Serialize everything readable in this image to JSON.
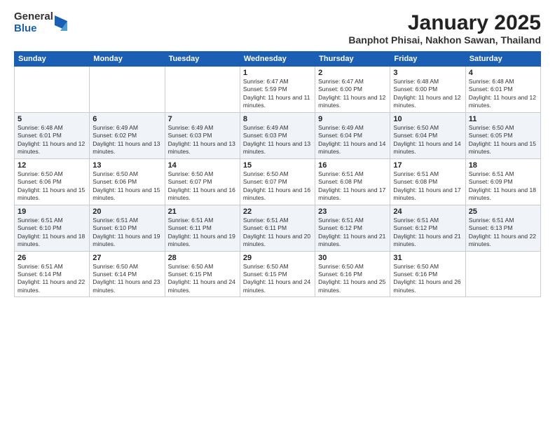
{
  "logo": {
    "general": "General",
    "blue": "Blue"
  },
  "title": "January 2025",
  "location": "Banphot Phisai, Nakhon Sawan, Thailand",
  "days_of_week": [
    "Sunday",
    "Monday",
    "Tuesday",
    "Wednesday",
    "Thursday",
    "Friday",
    "Saturday"
  ],
  "weeks": [
    [
      {
        "day": "",
        "sunrise": "",
        "sunset": "",
        "daylight": ""
      },
      {
        "day": "",
        "sunrise": "",
        "sunset": "",
        "daylight": ""
      },
      {
        "day": "",
        "sunrise": "",
        "sunset": "",
        "daylight": ""
      },
      {
        "day": "1",
        "sunrise": "Sunrise: 6:47 AM",
        "sunset": "Sunset: 5:59 PM",
        "daylight": "Daylight: 11 hours and 11 minutes."
      },
      {
        "day": "2",
        "sunrise": "Sunrise: 6:47 AM",
        "sunset": "Sunset: 6:00 PM",
        "daylight": "Daylight: 11 hours and 12 minutes."
      },
      {
        "day": "3",
        "sunrise": "Sunrise: 6:48 AM",
        "sunset": "Sunset: 6:00 PM",
        "daylight": "Daylight: 11 hours and 12 minutes."
      },
      {
        "day": "4",
        "sunrise": "Sunrise: 6:48 AM",
        "sunset": "Sunset: 6:01 PM",
        "daylight": "Daylight: 11 hours and 12 minutes."
      }
    ],
    [
      {
        "day": "5",
        "sunrise": "Sunrise: 6:48 AM",
        "sunset": "Sunset: 6:01 PM",
        "daylight": "Daylight: 11 hours and 12 minutes."
      },
      {
        "day": "6",
        "sunrise": "Sunrise: 6:49 AM",
        "sunset": "Sunset: 6:02 PM",
        "daylight": "Daylight: 11 hours and 13 minutes."
      },
      {
        "day": "7",
        "sunrise": "Sunrise: 6:49 AM",
        "sunset": "Sunset: 6:03 PM",
        "daylight": "Daylight: 11 hours and 13 minutes."
      },
      {
        "day": "8",
        "sunrise": "Sunrise: 6:49 AM",
        "sunset": "Sunset: 6:03 PM",
        "daylight": "Daylight: 11 hours and 13 minutes."
      },
      {
        "day": "9",
        "sunrise": "Sunrise: 6:49 AM",
        "sunset": "Sunset: 6:04 PM",
        "daylight": "Daylight: 11 hours and 14 minutes."
      },
      {
        "day": "10",
        "sunrise": "Sunrise: 6:50 AM",
        "sunset": "Sunset: 6:04 PM",
        "daylight": "Daylight: 11 hours and 14 minutes."
      },
      {
        "day": "11",
        "sunrise": "Sunrise: 6:50 AM",
        "sunset": "Sunset: 6:05 PM",
        "daylight": "Daylight: 11 hours and 15 minutes."
      }
    ],
    [
      {
        "day": "12",
        "sunrise": "Sunrise: 6:50 AM",
        "sunset": "Sunset: 6:06 PM",
        "daylight": "Daylight: 11 hours and 15 minutes."
      },
      {
        "day": "13",
        "sunrise": "Sunrise: 6:50 AM",
        "sunset": "Sunset: 6:06 PM",
        "daylight": "Daylight: 11 hours and 15 minutes."
      },
      {
        "day": "14",
        "sunrise": "Sunrise: 6:50 AM",
        "sunset": "Sunset: 6:07 PM",
        "daylight": "Daylight: 11 hours and 16 minutes."
      },
      {
        "day": "15",
        "sunrise": "Sunrise: 6:50 AM",
        "sunset": "Sunset: 6:07 PM",
        "daylight": "Daylight: 11 hours and 16 minutes."
      },
      {
        "day": "16",
        "sunrise": "Sunrise: 6:51 AM",
        "sunset": "Sunset: 6:08 PM",
        "daylight": "Daylight: 11 hours and 17 minutes."
      },
      {
        "day": "17",
        "sunrise": "Sunrise: 6:51 AM",
        "sunset": "Sunset: 6:08 PM",
        "daylight": "Daylight: 11 hours and 17 minutes."
      },
      {
        "day": "18",
        "sunrise": "Sunrise: 6:51 AM",
        "sunset": "Sunset: 6:09 PM",
        "daylight": "Daylight: 11 hours and 18 minutes."
      }
    ],
    [
      {
        "day": "19",
        "sunrise": "Sunrise: 6:51 AM",
        "sunset": "Sunset: 6:10 PM",
        "daylight": "Daylight: 11 hours and 18 minutes."
      },
      {
        "day": "20",
        "sunrise": "Sunrise: 6:51 AM",
        "sunset": "Sunset: 6:10 PM",
        "daylight": "Daylight: 11 hours and 19 minutes."
      },
      {
        "day": "21",
        "sunrise": "Sunrise: 6:51 AM",
        "sunset": "Sunset: 6:11 PM",
        "daylight": "Daylight: 11 hours and 19 minutes."
      },
      {
        "day": "22",
        "sunrise": "Sunrise: 6:51 AM",
        "sunset": "Sunset: 6:11 PM",
        "daylight": "Daylight: 11 hours and 20 minutes."
      },
      {
        "day": "23",
        "sunrise": "Sunrise: 6:51 AM",
        "sunset": "Sunset: 6:12 PM",
        "daylight": "Daylight: 11 hours and 21 minutes."
      },
      {
        "day": "24",
        "sunrise": "Sunrise: 6:51 AM",
        "sunset": "Sunset: 6:12 PM",
        "daylight": "Daylight: 11 hours and 21 minutes."
      },
      {
        "day": "25",
        "sunrise": "Sunrise: 6:51 AM",
        "sunset": "Sunset: 6:13 PM",
        "daylight": "Daylight: 11 hours and 22 minutes."
      }
    ],
    [
      {
        "day": "26",
        "sunrise": "Sunrise: 6:51 AM",
        "sunset": "Sunset: 6:14 PM",
        "daylight": "Daylight: 11 hours and 22 minutes."
      },
      {
        "day": "27",
        "sunrise": "Sunrise: 6:50 AM",
        "sunset": "Sunset: 6:14 PM",
        "daylight": "Daylight: 11 hours and 23 minutes."
      },
      {
        "day": "28",
        "sunrise": "Sunrise: 6:50 AM",
        "sunset": "Sunset: 6:15 PM",
        "daylight": "Daylight: 11 hours and 24 minutes."
      },
      {
        "day": "29",
        "sunrise": "Sunrise: 6:50 AM",
        "sunset": "Sunset: 6:15 PM",
        "daylight": "Daylight: 11 hours and 24 minutes."
      },
      {
        "day": "30",
        "sunrise": "Sunrise: 6:50 AM",
        "sunset": "Sunset: 6:16 PM",
        "daylight": "Daylight: 11 hours and 25 minutes."
      },
      {
        "day": "31",
        "sunrise": "Sunrise: 6:50 AM",
        "sunset": "Sunset: 6:16 PM",
        "daylight": "Daylight: 11 hours and 26 minutes."
      },
      {
        "day": "",
        "sunrise": "",
        "sunset": "",
        "daylight": ""
      }
    ]
  ]
}
